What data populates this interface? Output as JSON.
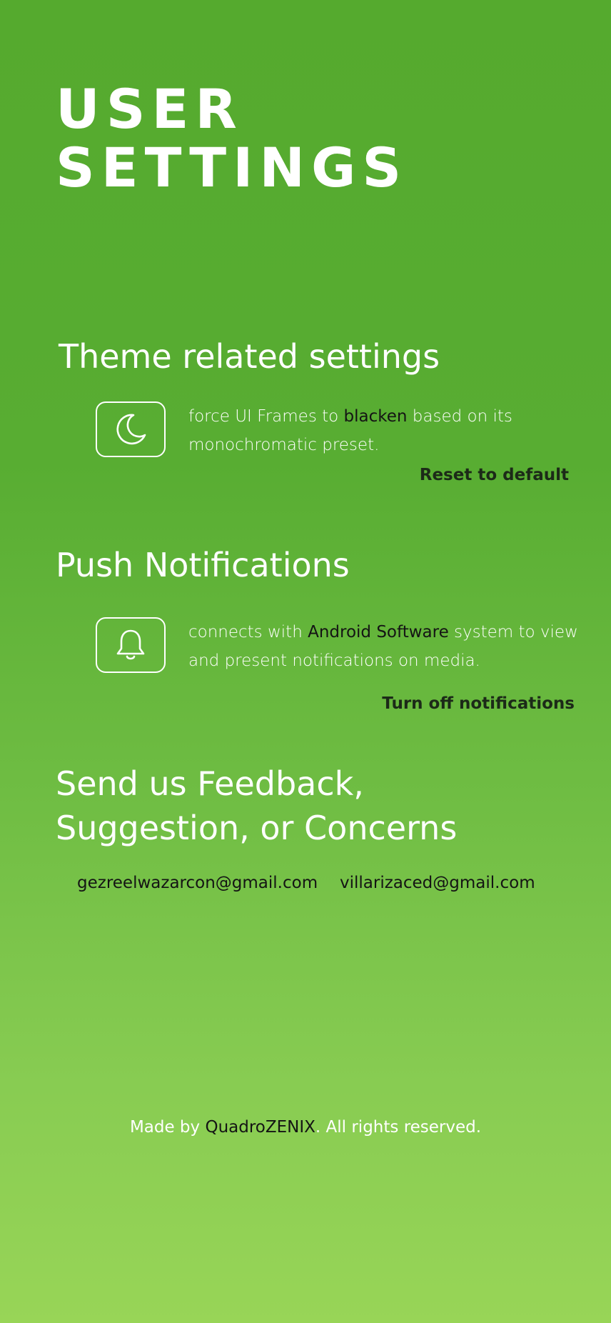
{
  "page": {
    "title_line1": "USER",
    "title_line2": "SETTINGS"
  },
  "theme": {
    "heading": "Theme related settings",
    "icon": "moon-icon",
    "desc_before": "force UI Frames to ",
    "desc_highlight": "blacken",
    "desc_after": " based on its monochromatic preset.",
    "action_label": "Reset to default"
  },
  "notifications": {
    "heading": "Push Notifications",
    "icon": "bell-icon",
    "desc_before": "connects with ",
    "desc_highlight": "Android Software",
    "desc_after": " system to view and present notifications on media.",
    "action_label": "Turn off notifications"
  },
  "feedback": {
    "heading_line1": "Send us Feedback,",
    "heading_line2": "Suggestion, or Concerns",
    "emails": [
      "gezreelwazarcon@gmail.com",
      "villarizaced@gmail.com"
    ]
  },
  "footer": {
    "before": "Made by ",
    "brand": "QuadroZENIX",
    "after": ". All rights reserved."
  },
  "colors": {
    "background_top": "#55aa2e",
    "background_bottom": "#98d557",
    "text": "#ffffff",
    "highlight": "#141414",
    "action": "#1c2a18"
  }
}
